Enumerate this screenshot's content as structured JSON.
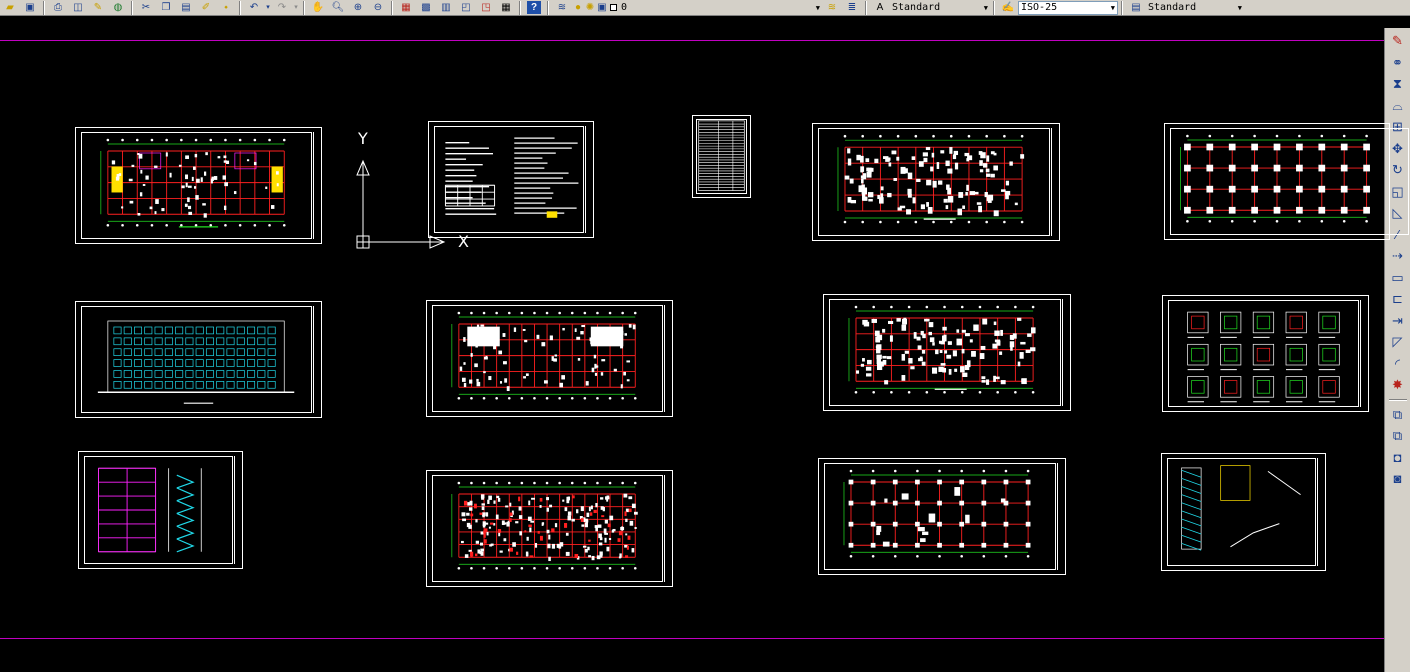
{
  "toolbar": {
    "layer_name": "0",
    "text_style": "Standard",
    "dim_style": "ISO-25",
    "table_style": "Standard"
  },
  "ucs": {
    "y_label": "Y",
    "x_label": "X"
  },
  "colors": {
    "background": "#000000",
    "frame": "#ffffff",
    "grid_red": "#ff2020",
    "dim_green": "#22e022",
    "detail_white": "#ffffff",
    "elevation_cyan": "#20d8e8",
    "highlight_yellow": "#ffe000",
    "highlight_magenta": "#ff20ff",
    "boundary_magenta": "#c000c0"
  },
  "icons": {
    "standard_toolbar": [
      "new-icon",
      "open-icon",
      "save-icon",
      "plot-icon",
      "plot-preview-icon",
      "publish-icon",
      "3d-dwf-icon",
      "cut-icon",
      "copy-icon",
      "paste-icon",
      "match-properties-icon",
      "block-editor-icon",
      "undo-icon",
      "redo-icon",
      "pan-icon",
      "zoom-realtime-icon",
      "zoom-window-icon",
      "zoom-previous-icon",
      "properties-icon",
      "design-center-icon",
      "tool-palettes-icon",
      "sheet-set-icon",
      "markup-icon",
      "calculator-icon",
      "help-icon"
    ],
    "layers_toolbar": [
      "layer-manager-icon",
      "light-bulb-icon",
      "sun-icon",
      "lock-icon"
    ],
    "modify_toolbar": [
      "erase-icon",
      "copy-object-icon",
      "mirror-icon",
      "offset-icon",
      "array-icon",
      "move-icon",
      "rotate-icon",
      "scale-icon",
      "stretch-icon",
      "trim-icon",
      "extend-icon",
      "break-at-point-icon",
      "break-icon",
      "join-icon",
      "chamfer-icon",
      "fillet-icon",
      "explode-icon",
      "draw-order-front-icon",
      "draw-order-back-icon",
      "draw-order-above-icon",
      "draw-order-under-icon"
    ]
  }
}
